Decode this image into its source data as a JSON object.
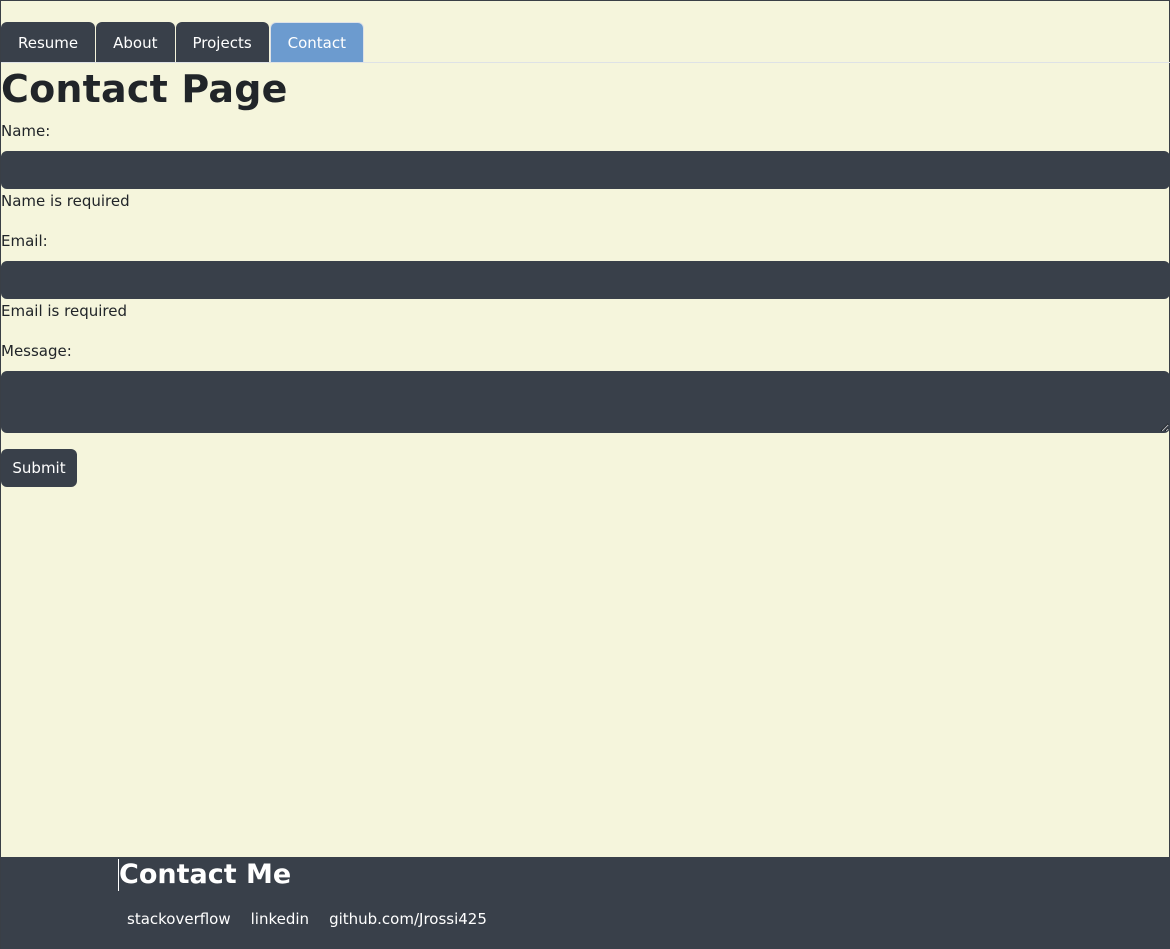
{
  "nav": {
    "tabs": [
      {
        "label": "Resume",
        "active": false
      },
      {
        "label": "About",
        "active": false
      },
      {
        "label": "Projects",
        "active": false
      },
      {
        "label": "Contact",
        "active": true
      }
    ]
  },
  "main": {
    "title": "Contact Page",
    "form": {
      "name": {
        "label": "Name:",
        "value": "",
        "error": "Name is required"
      },
      "email": {
        "label": "Email:",
        "value": "",
        "error": "Email is required"
      },
      "message": {
        "label": "Message:",
        "value": ""
      },
      "submit_label": "Submit"
    }
  },
  "footer": {
    "title": "Contact Me",
    "links": [
      {
        "label": "stackoverflow"
      },
      {
        "label": "linkedin"
      },
      {
        "label": "github.com/Jrossi425"
      }
    ]
  },
  "colors": {
    "background": "#f5f5dc",
    "dark": "#39404a",
    "active_tab": "#6c9bcf"
  }
}
